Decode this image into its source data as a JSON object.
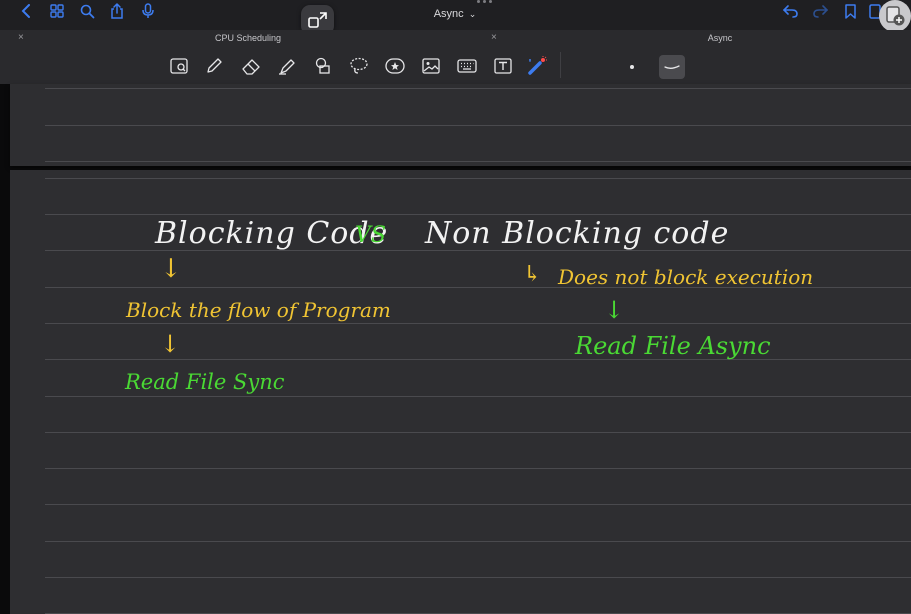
{
  "topbar": {
    "doc_title": "Async",
    "title_chevron": "⌄"
  },
  "tabs": [
    {
      "label": "CPU Scheduling",
      "close": "×"
    },
    {
      "label": "Async",
      "close": "×"
    }
  ],
  "note": {
    "heading_left": "Blocking Code",
    "heading_vs": "VS",
    "heading_right": "Non Blocking code",
    "arrow_left_1": "↓",
    "left_point_1": "Block the flow of Program",
    "arrow_left_2": "↓",
    "left_point_2": "Read File Sync",
    "arrow_right_1": "↳",
    "right_point_1": "Does not block execution",
    "arrow_right_2": "↓",
    "right_point_2": "Read File Async"
  },
  "colors": {
    "ink_white": "#f2f2f2",
    "ink_yellow": "#f0c433",
    "ink_green": "#4ad934",
    "accent_blue": "#3d7cf0"
  }
}
